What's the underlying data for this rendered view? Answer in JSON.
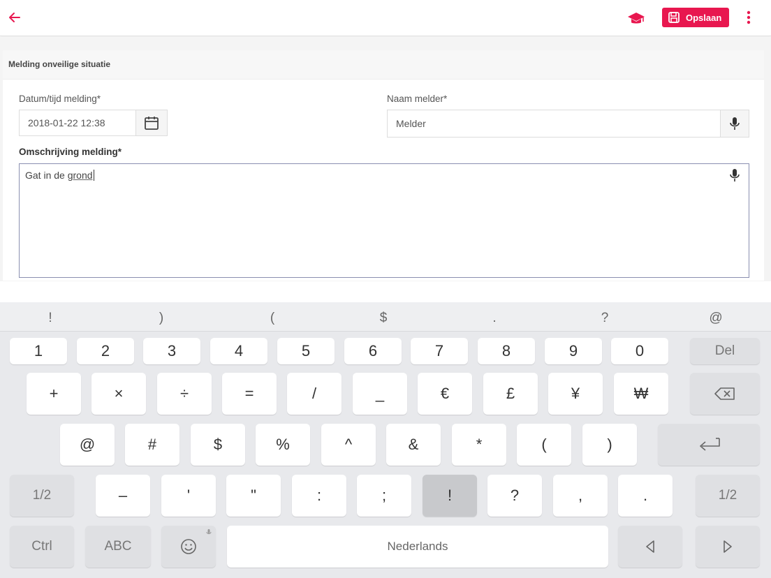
{
  "toolbar": {
    "save_label": "Opslaan"
  },
  "form": {
    "section_title": "Melding onveilige situatie",
    "datetime_label": "Datum/tijd melding*",
    "datetime_value": "2018-01-22 12:38",
    "name_label": "Naam melder*",
    "name_value": "Melder",
    "description_label": "Omschrijving melding*",
    "description_prefix": "Gat in de ",
    "description_typed": "grond"
  },
  "keyboard": {
    "suggestions": [
      "!",
      ")",
      "(",
      "$",
      ".",
      "?",
      "@"
    ],
    "row1": [
      "1",
      "2",
      "3",
      "4",
      "5",
      "6",
      "7",
      "8",
      "9",
      "0"
    ],
    "del_label": "Del",
    "row2": [
      "+",
      "×",
      "÷",
      "=",
      "/",
      "_",
      "€",
      "£",
      "¥",
      "₩"
    ],
    "row3": [
      "@",
      "#",
      "$",
      "%",
      "^",
      "&",
      "*",
      "(",
      ")"
    ],
    "page_label": "1/2",
    "row4": [
      "–",
      "'",
      "\"",
      ":",
      ";",
      "!",
      "?",
      ",",
      "."
    ],
    "ctrl_label": "Ctrl",
    "abc_label": "ABC",
    "space_label": "Nederlands"
  },
  "colors": {
    "accent": "#e8174f",
    "keyboard_bg": "#e8e9ec"
  }
}
